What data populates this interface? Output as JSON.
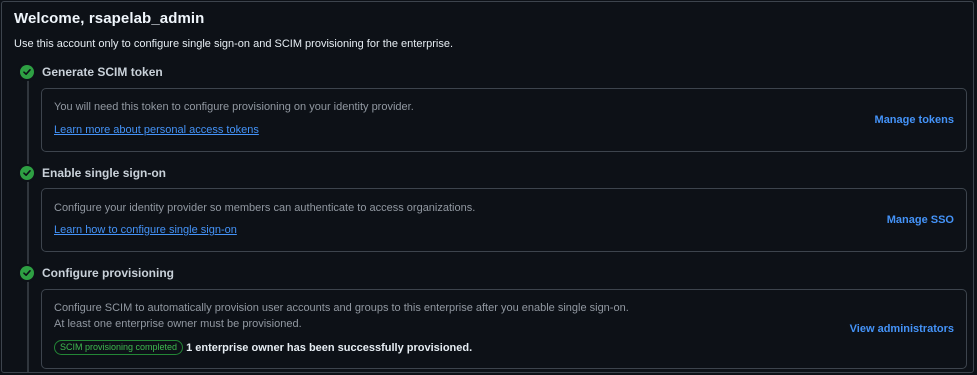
{
  "header": {
    "title": "Welcome, rsapelab_admin",
    "subtitle": "Use this account only to configure single sign-on and SCIM provisioning for the enterprise."
  },
  "steps": [
    {
      "title": "Generate SCIM token",
      "status_icon": "check-circle-icon",
      "description": "You will need this token to configure provisioning on your identity provider.",
      "link": "Learn more about personal access tokens",
      "action": "Manage tokens"
    },
    {
      "title": "Enable single sign-on",
      "status_icon": "check-circle-icon",
      "description": "Configure your identity provider so members can authenticate to access organizations.",
      "link": "Learn how to configure single sign-on",
      "action": "Manage SSO"
    },
    {
      "title": "Configure provisioning",
      "status_icon": "check-circle-icon",
      "description": "Configure SCIM to automatically provision user accounts and groups to this enterprise after you enable single sign-on.",
      "description_2": "At least one enterprise owner must be provisioned.",
      "badge": "SCIM provisioning completed",
      "status_text": "1 enterprise owner has been successfully provisioned.",
      "action": "View administrators"
    }
  ],
  "colors": {
    "background": "#0d1117",
    "border": "#3d444d",
    "link": "#4493f8",
    "success": "#2ea043",
    "muted_text": "#9198a1"
  }
}
